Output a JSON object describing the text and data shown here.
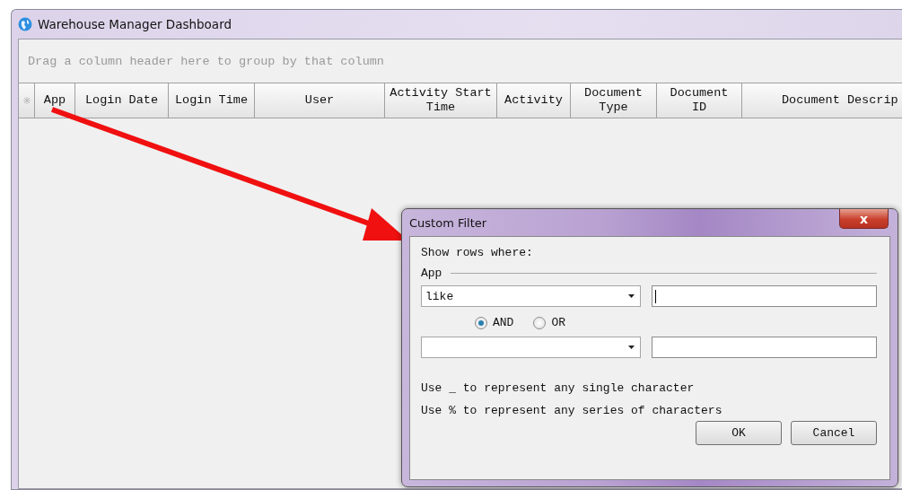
{
  "window": {
    "title": "Warehouse Manager Dashboard"
  },
  "group_panel": {
    "hint": "Drag a column header here to group by that column"
  },
  "table": {
    "columns": [
      "App",
      "Login Date",
      "Login Time",
      "User",
      "Activity Start Time",
      "Activity",
      "Document Type",
      "Document ID",
      "Document Descrip"
    ]
  },
  "dialog": {
    "title": "Custom Filter",
    "close": "x",
    "prompt": "Show rows where:",
    "field_label": "App",
    "condition_1": {
      "operator": "like",
      "value_focused": true
    },
    "logic": [
      {
        "label": "AND",
        "selected": true
      },
      {
        "label": "OR",
        "selected": false
      }
    ],
    "hints": [
      "Use _ to represent any single character",
      "Use % to represent any series of characters"
    ],
    "buttons": [
      "OK",
      "Cancel"
    ]
  }
}
